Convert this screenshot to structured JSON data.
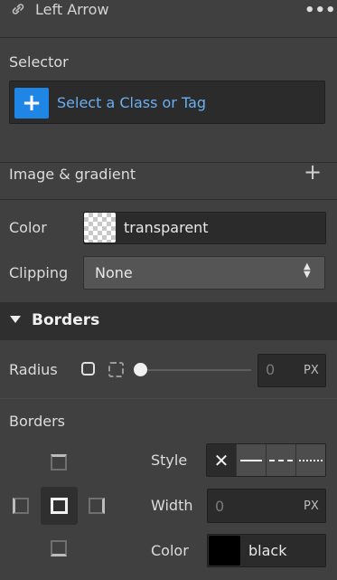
{
  "element": {
    "name": "Left Arrow",
    "more_label": "•••"
  },
  "selector": {
    "label": "Selector",
    "placeholder": "Select a Class or Tag"
  },
  "background": {
    "image_gradient_label": "Image & gradient",
    "add_label": "+"
  },
  "color_row": {
    "label": "Color",
    "value": "transparent"
  },
  "clipping_row": {
    "label": "Clipping",
    "value": "None"
  },
  "borders_section": {
    "title": "Borders"
  },
  "radius_row": {
    "label": "Radius",
    "value": "0",
    "unit": "PX",
    "slider_value": 0
  },
  "borders_sub": {
    "label": "Borders",
    "style_label": "Style",
    "style_options": [
      "none",
      "solid",
      "dashed",
      "dotted"
    ],
    "selected_style": "none",
    "width_label": "Width",
    "width_value": "0",
    "width_unit": "PX",
    "color_label": "Color",
    "color_value": "black"
  },
  "colors": {
    "accent": "#1f86e6",
    "link": "#6aaff2",
    "panel": "#404040",
    "header": "#2f2f2f"
  }
}
